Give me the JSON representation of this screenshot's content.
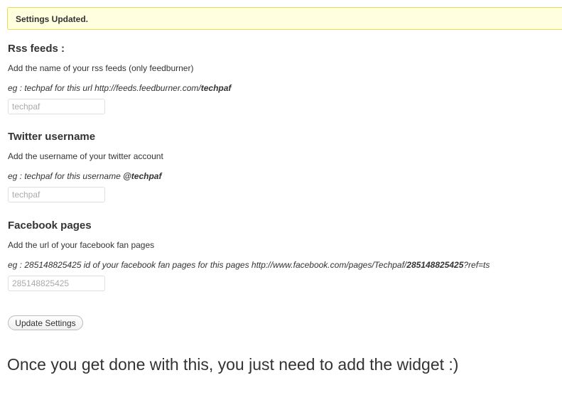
{
  "notice": {
    "text": "Settings Updated."
  },
  "sections": [
    {
      "title": "Rss feeds :",
      "description": "Add the name of your rss feeds (only feedburner)",
      "example_prefix": "eg : techpaf for this url http://feeds.feedburner.com/",
      "example_bold": "techpaf",
      "example_suffix": "",
      "input_placeholder": "techpaf"
    },
    {
      "title": "Twitter username",
      "description": "Add the username of your twitter account",
      "example_prefix": "eg : techpaf for this username ",
      "example_bold": "@techpaf",
      "example_suffix": "",
      "input_placeholder": "techpaf"
    },
    {
      "title": "Facebook pages",
      "description": "Add the url of your facebook fan pages",
      "example_prefix": "eg : 285148825425 id of your facebook fan pages for this pages http://www.facebook.com/pages/Techpaf/",
      "example_bold": "285148825425",
      "example_suffix": "?ref=ts",
      "input_placeholder": "285148825425"
    }
  ],
  "submit_label": "Update Settings",
  "footer_text": "Once you get done with this, you just need to add the widget :)"
}
